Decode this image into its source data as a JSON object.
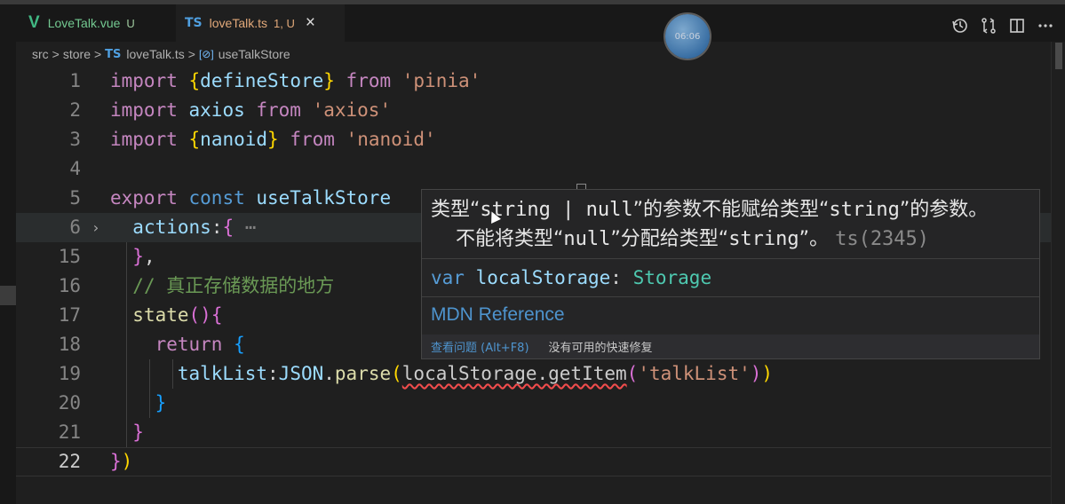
{
  "tabs": [
    {
      "icon": "vue-icon",
      "icon_text": "V",
      "title": "LoveTalk.vue",
      "status": "U"
    },
    {
      "icon": "ts-icon",
      "icon_text": "TS",
      "title": "loveTalk.ts",
      "status": "1, U",
      "close": "×"
    }
  ],
  "timer": "06:06",
  "breadcrumb": {
    "items": [
      "src",
      "store",
      "loveTalk.ts",
      "useTalkStore"
    ],
    "ts_badge": "TS",
    "symbol_icon": "[⊘]",
    "separator": ">"
  },
  "editor": {
    "lines": [
      {
        "num": "1",
        "tokens": [
          [
            "kw",
            "import "
          ],
          [
            "br1",
            "{"
          ],
          [
            "id",
            "defineStore"
          ],
          [
            "br1",
            "}"
          ],
          [
            "kw",
            " from "
          ],
          [
            "str",
            "'pinia'"
          ]
        ]
      },
      {
        "num": "2",
        "tokens": [
          [
            "kw",
            "import "
          ],
          [
            "id",
            "axios"
          ],
          [
            "kw",
            " from "
          ],
          [
            "str",
            "'axios'"
          ]
        ]
      },
      {
        "num": "3",
        "tokens": [
          [
            "kw",
            "import "
          ],
          [
            "br1",
            "{"
          ],
          [
            "id",
            "nanoid"
          ],
          [
            "br1",
            "}"
          ],
          [
            "kw",
            " from "
          ],
          [
            "str",
            "'nanoid'"
          ]
        ]
      },
      {
        "num": "4",
        "tokens": []
      },
      {
        "num": "5",
        "tokens": [
          [
            "kw",
            "export "
          ],
          [
            "kwb",
            "const "
          ],
          [
            "id",
            "useTalkStore"
          ]
        ]
      },
      {
        "num": "6",
        "fold": "›",
        "tokens": [
          [
            "pl",
            "  "
          ],
          [
            "id",
            "actions"
          ],
          [
            "pl",
            ":"
          ],
          [
            "br2",
            "{"
          ],
          [
            "dim",
            " ⋯"
          ]
        ]
      },
      {
        "num": "15",
        "tokens": [
          [
            "pl",
            "  "
          ],
          [
            "br2",
            "}"
          ],
          [
            "pl",
            ","
          ]
        ]
      },
      {
        "num": "16",
        "tokens": [
          [
            "pl",
            "  "
          ],
          [
            "cm",
            "// 真正存储数据的地方"
          ]
        ]
      },
      {
        "num": "17",
        "tokens": [
          [
            "pl",
            "  "
          ],
          [
            "fn",
            "state"
          ],
          [
            "br2",
            "()"
          ],
          [
            "br2",
            "{"
          ]
        ]
      },
      {
        "num": "18",
        "tokens": [
          [
            "pl",
            "    "
          ],
          [
            "kw",
            "return "
          ],
          [
            "br3",
            "{"
          ]
        ]
      },
      {
        "num": "19",
        "tokens": [
          [
            "pl",
            "      "
          ],
          [
            "id",
            "talkList"
          ],
          [
            "pl",
            ":"
          ],
          [
            "id",
            "JSON"
          ],
          [
            "pl",
            "."
          ],
          [
            "fn",
            "parse"
          ],
          [
            "br1",
            "("
          ],
          [
            "squig",
            "localStorage.getItem"
          ],
          [
            "br2",
            "("
          ],
          [
            "str",
            "'talkList'"
          ],
          [
            "br2",
            ")"
          ],
          [
            "br1",
            ")"
          ]
        ]
      },
      {
        "num": "20",
        "tokens": [
          [
            "pl",
            "    "
          ],
          [
            "br3",
            "}"
          ]
        ]
      },
      {
        "num": "21",
        "tokens": [
          [
            "pl",
            "  "
          ],
          [
            "br2",
            "}"
          ]
        ]
      },
      {
        "num": "22",
        "tokens": [
          [
            "br2",
            "}"
          ],
          [
            "br1",
            ")"
          ]
        ]
      }
    ]
  },
  "hover": {
    "message_line1_a": "类型“",
    "message_line1_b": "string | null",
    "message_line1_c": "”的参数不能赋给类型“",
    "message_line1_d": "string",
    "message_line1_e": "”的参数。",
    "message_line2_a": "不能将类型“",
    "message_line2_b": "null",
    "message_line2_c": "”分配给类型“",
    "message_line2_d": "string",
    "message_line2_e": "”。",
    "error_code": "ts(2345)",
    "signature": {
      "keyword": "var ",
      "name": "localStorage",
      "colon": ": ",
      "type": "Storage"
    },
    "link": "MDN Reference",
    "view_problem": "查看问题 (Alt+F8)",
    "no_quick_fix": "没有可用的快速修复"
  },
  "colors": {
    "accent": "#4e94ce",
    "error": "#f14c4c",
    "modified": "#e2a97a",
    "untracked": "#73c991"
  }
}
